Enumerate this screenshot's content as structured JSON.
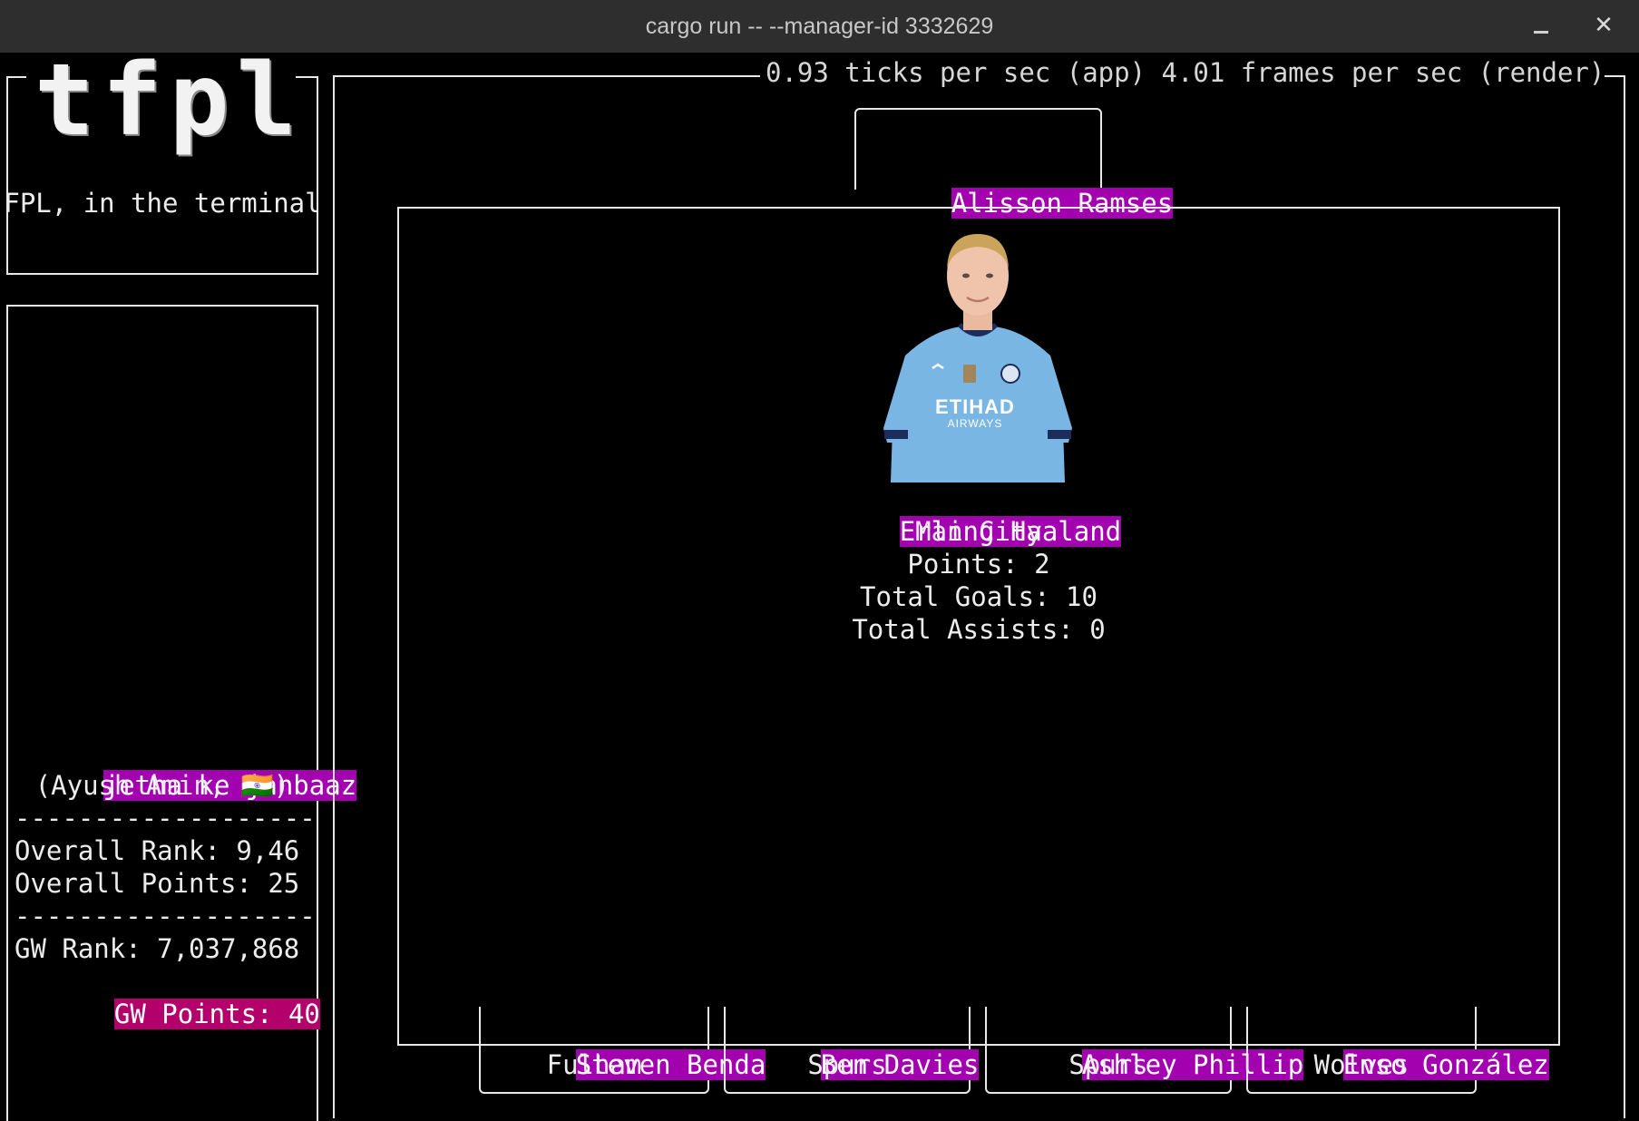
{
  "window": {
    "title": "cargo run -- --manager-id 3332629"
  },
  "logo": {
    "text": "tfpl",
    "tagline": "FPL, in the terminal"
  },
  "stats_line": "0.93 ticks per sec (app) 4.01 frames per sec (render)",
  "manager": {
    "team_name": "jetha ke janbaaz",
    "owner_line": "(Ayush Amin, 🇮🇳)",
    "separator": "-------------------",
    "overall_rank": "Overall Rank: 9,46",
    "overall_points": "Overall Points: 25",
    "gw_rank": "GW Rank: 7,037,868",
    "gw_points": "GW Points: 40"
  },
  "goalkeeper": {
    "name": "Alisson Ramses"
  },
  "selected_player": {
    "name": "Erling Haaland",
    "team": "Man City",
    "points": "Points: 2",
    "total_goals": "Total Goals: 10",
    "total_assists": "Total Assists: 0",
    "shirt_sponsor": "ETIHAD",
    "shirt_sponsor_sub": "AIRWAYS",
    "colors": {
      "shirt": "#7ab6e4",
      "trim": "#1c2c5b"
    }
  },
  "bench": [
    {
      "name": "Steven Benda",
      "team": "Fulham"
    },
    {
      "name": "Ben Davies",
      "team": "Spurs"
    },
    {
      "name": "Ashley Phillip",
      "team": "Spurs"
    },
    {
      "name": "Enso González",
      "team": "Wolves"
    }
  ],
  "colors": {
    "highlight": "#a300b0",
    "highlight_points": "#b4006a",
    "background": "#000000",
    "titlebar": "#2e2e2e"
  }
}
